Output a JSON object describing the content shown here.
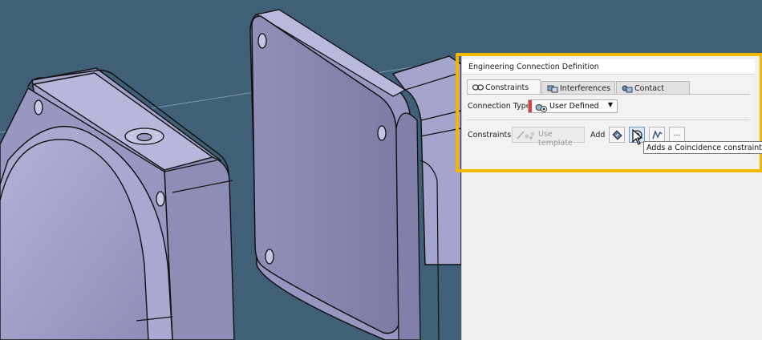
{
  "dialog": {
    "title": "Engineering Connection Definition",
    "tabs": [
      {
        "label": "Constraints",
        "icon": "constraints-icon",
        "active": true
      },
      {
        "label": "Interferences",
        "icon": "interferences-icon",
        "active": false
      },
      {
        "label": "Contact",
        "icon": "contact-icon",
        "active": false
      }
    ],
    "connection_type_label": "Connection Type",
    "connection_type_value": "User Defined",
    "constraints_label": "Constraints",
    "use_template_label": "Use template",
    "add_label": "Add",
    "more_label": "...",
    "tooltip": "Adds a Coincidence constraint"
  },
  "colors": {
    "viewport_background": "#3f6077",
    "part_face": "#9b9bc4",
    "highlight": "#f2b705",
    "connection_type_marker": "#d9403a"
  }
}
